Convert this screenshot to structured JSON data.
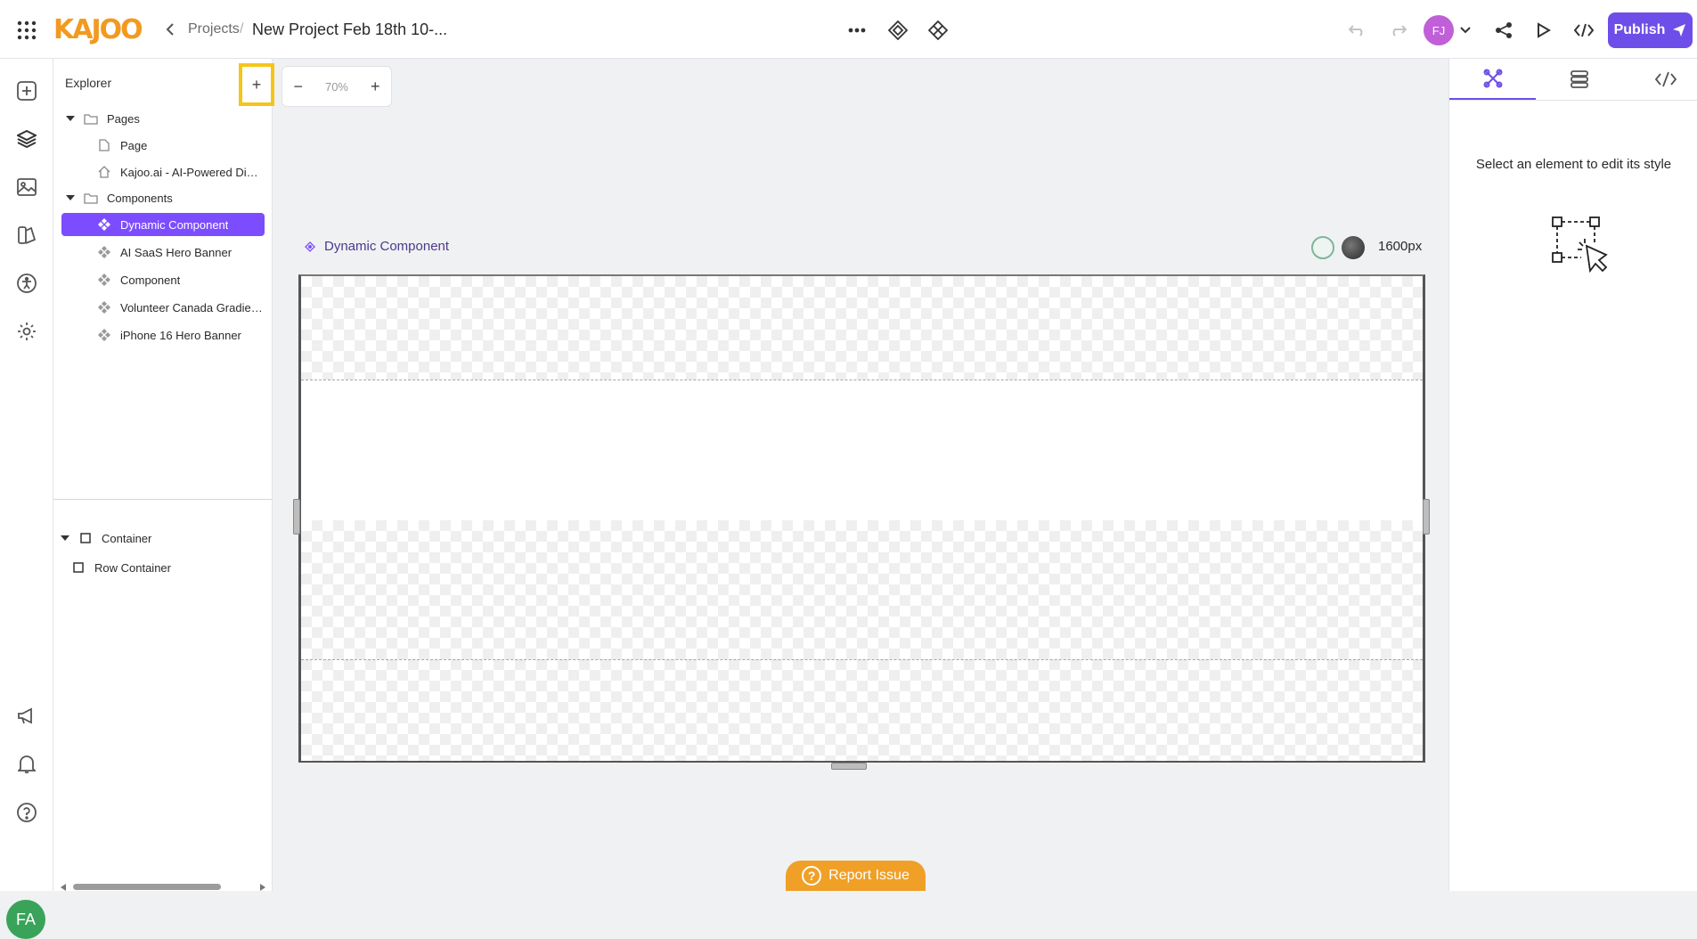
{
  "header": {
    "logo_text": "KAJOO",
    "breadcrumb_projects": "Projects",
    "breadcrumb_sep": "/",
    "project_title": "New Project Feb 18th 10-...",
    "user_initials": "FJ",
    "publish_label": "Publish",
    "icons": [
      "apps-grid-icon",
      "chevron-left-icon",
      "more-horizontal-icon",
      "component-icon",
      "component-outline-icon",
      "undo-icon",
      "redo-icon",
      "chevron-down-icon",
      "share-icon",
      "play-icon",
      "code-icon",
      "send-icon"
    ]
  },
  "rail": {
    "icons": [
      "add-square-icon",
      "layers-icon",
      "image-icon",
      "style-palette-icon",
      "accessibility-icon",
      "settings-icon",
      "megaphone-icon",
      "bell-icon",
      "help-icon"
    ],
    "user_initials": "FA"
  },
  "explorer": {
    "title": "Explorer",
    "add_label": "+",
    "pages_folder": "Pages",
    "pages": [
      {
        "label": "Page",
        "icon": "page-icon"
      },
      {
        "label": "Kajoo.ai - AI-Powered Digi...",
        "icon": "home-icon"
      }
    ],
    "components_folder": "Components",
    "components": [
      {
        "label": "Dynamic Component",
        "selected": true
      },
      {
        "label": "AI SaaS Hero Banner"
      },
      {
        "label": "Component"
      },
      {
        "label": "Volunteer Canada Gradien..."
      },
      {
        "label": "iPhone 16 Hero Banner"
      }
    ],
    "layers": [
      {
        "label": "Container"
      },
      {
        "label": "Row Container"
      }
    ]
  },
  "canvas": {
    "zoom_minus": "−",
    "zoom_value": "70%",
    "zoom_plus": "+",
    "component_name": "Dynamic Component",
    "width_label": "1600px",
    "light_swatch_color": "#e8f0ec",
    "dark_swatch_color": "#3a3a3a"
  },
  "right_panel": {
    "tabs": [
      "style-tab",
      "data-tab",
      "code-tab"
    ],
    "message": "Select an element to edit its style"
  },
  "report": {
    "label": "Report Issue"
  },
  "colors": {
    "accent": "#6e4ee8",
    "selected": "#7c4dff",
    "logo": "#f29a1f",
    "report": "#f0a026",
    "highlight": "#f5c518"
  }
}
